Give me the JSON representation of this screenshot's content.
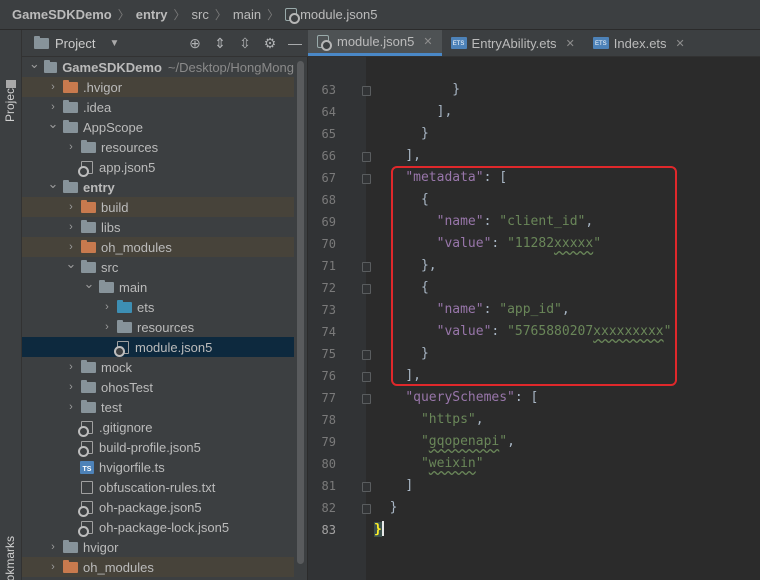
{
  "breadcrumb": [
    "GameSDKDemo",
    "entry",
    "src",
    "main",
    "module.json5"
  ],
  "stripe": {
    "project_label": "Project",
    "bookmarks_label": "Bookmarks"
  },
  "project_panel": {
    "title": "Project"
  },
  "tree": [
    {
      "label": "GameSDKDemo",
      "suffix": "~/Desktop/HongMong",
      "depth": 0,
      "arrow": "open",
      "icon": "folder-module",
      "bold": true
    },
    {
      "label": ".hvigor",
      "depth": 1,
      "arrow": "closed",
      "icon": "folder-orange",
      "excluded": true
    },
    {
      "label": ".idea",
      "depth": 1,
      "arrow": "closed",
      "icon": "folder"
    },
    {
      "label": "AppScope",
      "depth": 1,
      "arrow": "open",
      "icon": "folder"
    },
    {
      "label": "resources",
      "depth": 2,
      "arrow": "closed",
      "icon": "folder"
    },
    {
      "label": "app.json5",
      "depth": 2,
      "arrow": "none",
      "icon": "json-gear"
    },
    {
      "label": "entry",
      "depth": 1,
      "arrow": "open",
      "icon": "folder-module",
      "bold": true
    },
    {
      "label": "build",
      "depth": 2,
      "arrow": "closed",
      "icon": "folder-orange",
      "excluded": true
    },
    {
      "label": "libs",
      "depth": 2,
      "arrow": "closed",
      "icon": "folder"
    },
    {
      "label": "oh_modules",
      "depth": 2,
      "arrow": "closed",
      "icon": "folder-orange",
      "excluded": true
    },
    {
      "label": "src",
      "depth": 2,
      "arrow": "open",
      "icon": "folder"
    },
    {
      "label": "main",
      "depth": 3,
      "arrow": "open",
      "icon": "folder"
    },
    {
      "label": "ets",
      "depth": 4,
      "arrow": "closed",
      "icon": "folder-blue"
    },
    {
      "label": "resources",
      "depth": 4,
      "arrow": "closed",
      "icon": "folder"
    },
    {
      "label": "module.json5",
      "depth": 4,
      "arrow": "none",
      "icon": "json-gear",
      "selected": true
    },
    {
      "label": "mock",
      "depth": 2,
      "arrow": "closed",
      "icon": "folder"
    },
    {
      "label": "ohosTest",
      "depth": 2,
      "arrow": "closed",
      "icon": "folder"
    },
    {
      "label": "test",
      "depth": 2,
      "arrow": "closed",
      "icon": "folder"
    },
    {
      "label": ".gitignore",
      "depth": 2,
      "arrow": "none",
      "icon": "file-gear"
    },
    {
      "label": "build-profile.json5",
      "depth": 2,
      "arrow": "none",
      "icon": "json-gear"
    },
    {
      "label": "hvigorfile.ts",
      "depth": 2,
      "arrow": "none",
      "icon": "ts"
    },
    {
      "label": "obfuscation-rules.txt",
      "depth": 2,
      "arrow": "none",
      "icon": "file"
    },
    {
      "label": "oh-package.json5",
      "depth": 2,
      "arrow": "none",
      "icon": "json-gear"
    },
    {
      "label": "oh-package-lock.json5",
      "depth": 2,
      "arrow": "none",
      "icon": "json-gear"
    },
    {
      "label": "hvigor",
      "depth": 1,
      "arrow": "closed",
      "icon": "folder"
    },
    {
      "label": "oh_modules",
      "depth": 1,
      "arrow": "closed",
      "icon": "folder-orange",
      "excluded": true
    }
  ],
  "tabs": [
    {
      "label": "module.json5",
      "icon": "json-gear",
      "active": true
    },
    {
      "label": "EntryAbility.ets",
      "icon": "ets",
      "active": false
    },
    {
      "label": "Index.ets",
      "icon": "ets",
      "active": false
    }
  ],
  "editor": {
    "current_line": 83,
    "lines": [
      {
        "n": 63,
        "indent": 4,
        "code": "}"
      },
      {
        "n": 64,
        "indent": 3,
        "code": "],"
      },
      {
        "n": 65,
        "indent": 2,
        "code": "}"
      },
      {
        "n": 66,
        "indent": 1,
        "code": "],"
      },
      {
        "n": 67,
        "indent": 1,
        "code": "\"metadata\": ["
      },
      {
        "n": 68,
        "indent": 2,
        "code": "{"
      },
      {
        "n": 69,
        "indent": 3,
        "code": "\"name\": \"client_id\","
      },
      {
        "n": 70,
        "indent": 3,
        "code": "\"value\": \"11282xxxxx\""
      },
      {
        "n": 71,
        "indent": 2,
        "code": "},"
      },
      {
        "n": 72,
        "indent": 2,
        "code": "{"
      },
      {
        "n": 73,
        "indent": 3,
        "code": "\"name\": \"app_id\","
      },
      {
        "n": 74,
        "indent": 3,
        "code": "\"value\": \"5765880207xxxxxxxxx\""
      },
      {
        "n": 75,
        "indent": 2,
        "code": "}"
      },
      {
        "n": 76,
        "indent": 1,
        "code": "],"
      },
      {
        "n": 77,
        "indent": 1,
        "code": "\"querySchemes\": ["
      },
      {
        "n": 78,
        "indent": 2,
        "code": "\"https\","
      },
      {
        "n": 79,
        "indent": 2,
        "code": "\"gqopenapi\","
      },
      {
        "n": 80,
        "indent": 2,
        "code": "\"weixin\""
      },
      {
        "n": 81,
        "indent": 1,
        "code": "]"
      },
      {
        "n": 82,
        "indent": 0,
        "code": "}"
      },
      {
        "n": 83,
        "indent": -1,
        "code": "}"
      }
    ]
  },
  "colors": {
    "key": "#9876aa",
    "string": "#6a8759",
    "punct": "#a9b7c6",
    "highlight_box": "#e0282b",
    "active_tab_underline": "#4a88c7"
  }
}
